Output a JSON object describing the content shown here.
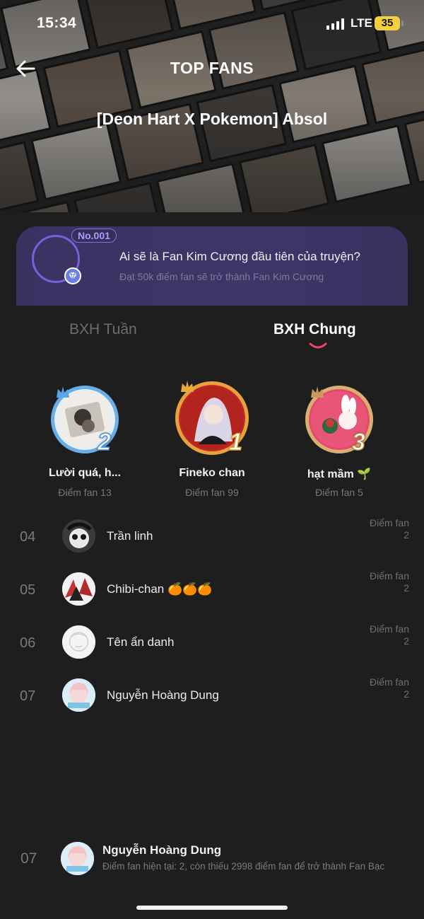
{
  "status_bar": {
    "time": "15:34",
    "network": "LTE",
    "battery": "35"
  },
  "header": {
    "title": "TOP FANS",
    "book_title": "[Deon Hart X Pokemon] Absol"
  },
  "diamond_banner": {
    "badge": "No.001",
    "question": "Ai sẽ là Fan Kim Cương đầu tiên của truyện?",
    "subtitle": "Đạt 50k điểm fan sẽ trở thành Fan Kim Cương"
  },
  "tabs": [
    {
      "label": "BXH Tuần",
      "active": false
    },
    {
      "label": "BXH Chung",
      "active": true
    }
  ],
  "podium": [
    {
      "rank": "1",
      "name": "Fineko chan",
      "points": "Điểm fan 99"
    },
    {
      "rank": "2",
      "name": "Lười quá, h...",
      "points": "Điểm fan 13"
    },
    {
      "rank": "3",
      "name": "hạt mầm 🌱",
      "points": "Điểm fan 5"
    }
  ],
  "list": [
    {
      "rank": "04",
      "name": "Trần linh",
      "label": "Điểm fan",
      "value": "2"
    },
    {
      "rank": "05",
      "name": "Chibi-chan 🍊🍊🍊",
      "label": "Điểm fan",
      "value": "2"
    },
    {
      "rank": "06",
      "name": "Tên ẩn danh",
      "label": "Điểm fan",
      "value": "2"
    },
    {
      "rank": "07",
      "name": "Nguyễn Hoàng Dung",
      "label": "Điểm fan",
      "value": "2"
    }
  ],
  "me": {
    "rank": "07",
    "name": "Nguyễn Hoàng Dung",
    "info": "Điểm fan hiện tại: 2, còn thiếu 2998 điểm fan để trở thành Fan Bạc"
  },
  "colors": {
    "accent": "#e8476a",
    "banner": "#3d3466",
    "gold": "#d8a232",
    "silver": "#6aaee8"
  }
}
